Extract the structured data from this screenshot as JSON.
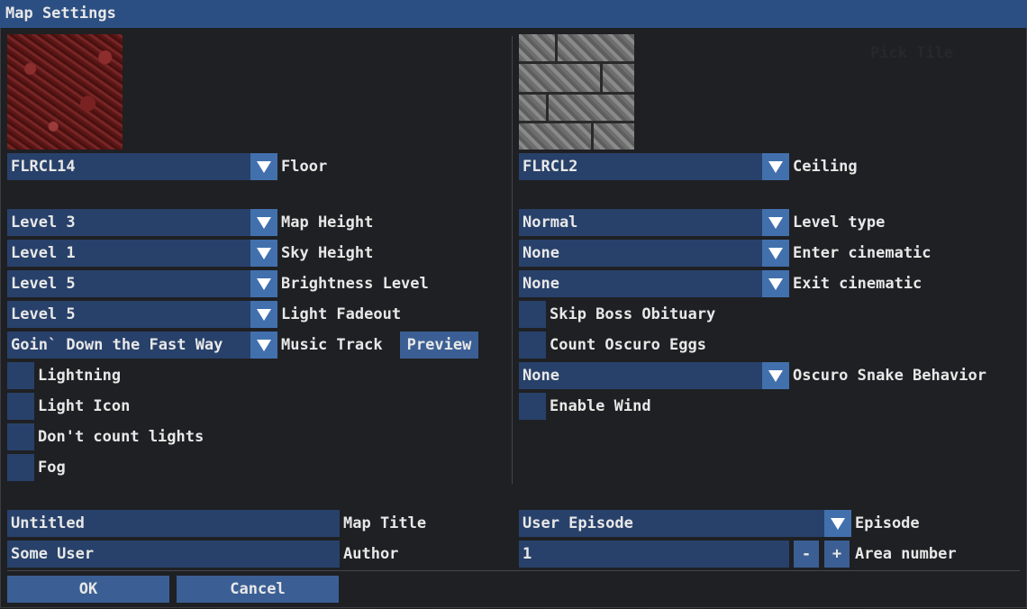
{
  "window": {
    "title": "Map Settings"
  },
  "left": {
    "floor": {
      "value": "FLRCL14",
      "label": "Floor"
    },
    "map_height": {
      "value": "Level 3",
      "label": "Map Height"
    },
    "sky_height": {
      "value": "Level 1",
      "label": "Sky Height"
    },
    "brightness": {
      "value": "Level 5",
      "label": "Brightness Level"
    },
    "light_fadeout": {
      "value": "Level 5",
      "label": "Light Fadeout"
    },
    "music_track": {
      "value": "Goin` Down the Fast Way",
      "label": "Music Track",
      "preview_label": "Preview"
    },
    "checkboxes": [
      {
        "label": "Lightning",
        "checked": false
      },
      {
        "label": "Light Icon",
        "checked": false
      },
      {
        "label": "Don't count lights",
        "checked": false
      },
      {
        "label": "Fog",
        "checked": false
      }
    ]
  },
  "right": {
    "pick_tile_label": "Pick Tile",
    "ceiling": {
      "value": "FLRCL2",
      "label": "Ceiling"
    },
    "level_type": {
      "value": "Normal",
      "label": "Level type"
    },
    "enter_cinematic": {
      "value": "None",
      "label": "Enter cinematic"
    },
    "exit_cinematic": {
      "value": "None",
      "label": "Exit cinematic"
    },
    "skip_boss": {
      "label": "Skip Boss Obituary",
      "checked": false
    },
    "count_eggs": {
      "label": "Count Oscuro Eggs",
      "checked": false
    },
    "snake_behavior": {
      "value": "None",
      "label": "Oscuro Snake Behavior"
    },
    "enable_wind": {
      "label": "Enable Wind",
      "checked": false
    }
  },
  "bottom": {
    "map_title": {
      "value": "Untitled",
      "label": "Map Title"
    },
    "author": {
      "value": "Some User",
      "label": "Author"
    },
    "episode": {
      "value": "User Episode",
      "label": "Episode"
    },
    "area_number": {
      "value": "1",
      "label": "Area number",
      "minus": "-",
      "plus": "+"
    }
  },
  "actions": {
    "ok": "OK",
    "cancel": "Cancel"
  },
  "colors": {
    "title_bar": "#2c4f83",
    "field_bg": "#28416a",
    "arrow_bg": "#4270ad",
    "button_bg": "#3b5f94"
  }
}
